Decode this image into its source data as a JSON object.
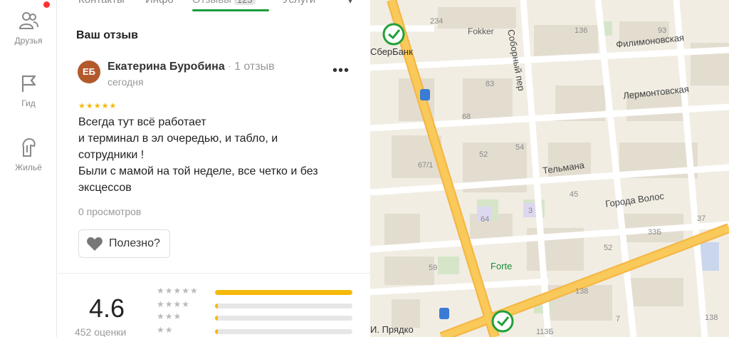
{
  "nav": {
    "items": [
      {
        "label": "Друзья",
        "icon": "friends-icon"
      },
      {
        "label": "Гид",
        "icon": "flag-icon"
      },
      {
        "label": "Жильё",
        "icon": "housing-icon"
      }
    ],
    "notification_color": "#ff3333"
  },
  "tabs": {
    "items": [
      "Контакты",
      "Инфо",
      "Отзывы",
      "Услуги"
    ],
    "active": "Отзывы",
    "reviews_badge": "123",
    "accent": "#1a9c3c"
  },
  "review": {
    "section_title": "Ваш отзыв",
    "avatar_initials": "ЕБ",
    "avatar_color": "#b35a2c",
    "author": "Екатерина Буробина",
    "author_reviews": "1 отзыв",
    "date": "сегодня",
    "stars": 5,
    "text_lines": [
      "Всегда тут всё работает",
      "и терминал в эл очередью, и табло, и",
      "сотрудники !",
      "Были с мамой на той неделе, все четко и без",
      "эксцессов"
    ],
    "views": "0 просмотров",
    "useful_label": "Полезно?"
  },
  "rating": {
    "value": "4.6",
    "count_label": "452 оценки",
    "distribution": [
      {
        "stars": 5,
        "fraction": 1.0
      },
      {
        "stars": 4,
        "fraction": 0.02
      },
      {
        "stars": 3,
        "fraction": 0.02
      },
      {
        "stars": 2,
        "fraction": 0.02
      }
    ],
    "bar_color": "#f5b90a"
  },
  "map": {
    "poi": [
      "СберБанк",
      "Fokker",
      "Forte",
      "И. Прядко"
    ],
    "streets": [
      "Соборный пер",
      "Филимоновская",
      "Лермонтовская",
      "Тельмана",
      "Города Волос"
    ],
    "house_numbers": [
      "234",
      "136",
      "93",
      "83",
      "68",
      "52",
      "54",
      "67/1",
      "45",
      "64",
      "3",
      "52",
      "37",
      "33Б",
      "59",
      "138",
      "113Б",
      "7",
      "138"
    ]
  }
}
